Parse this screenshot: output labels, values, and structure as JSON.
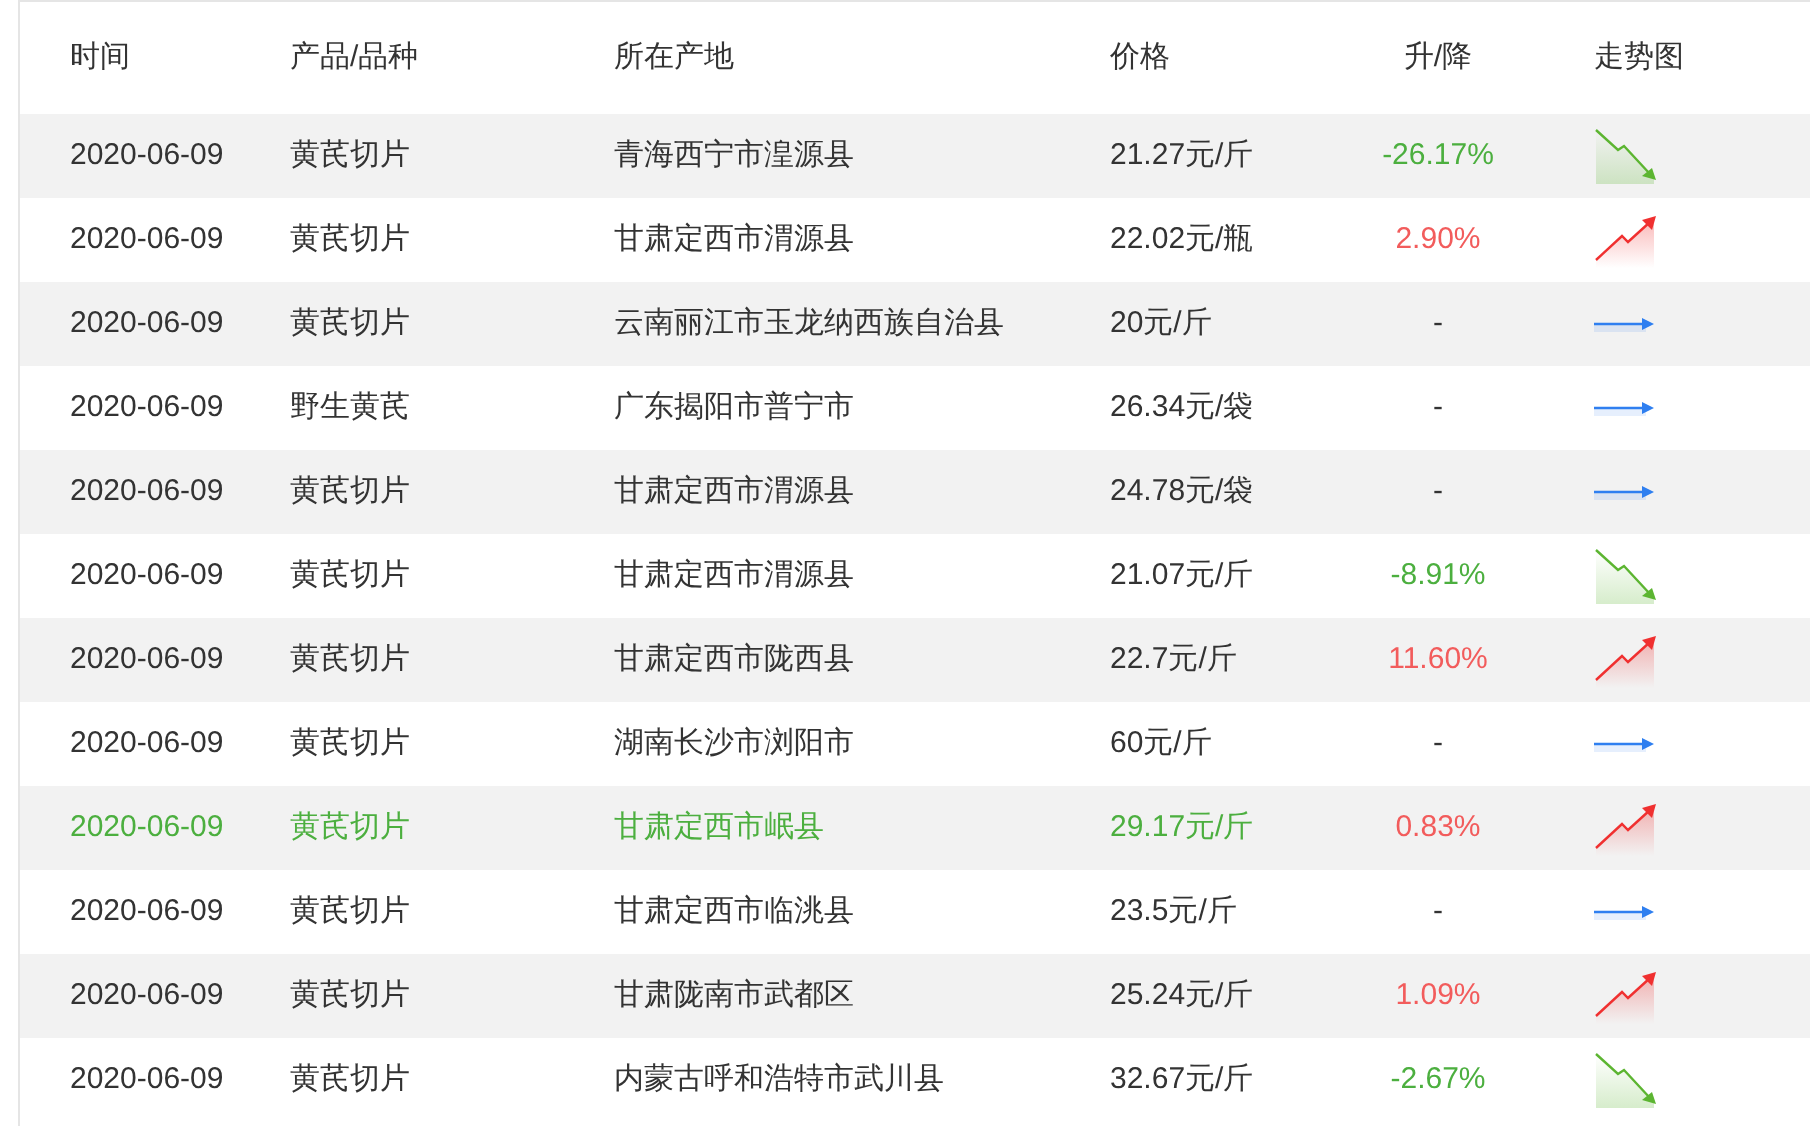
{
  "table": {
    "columns": [
      "时间",
      "产品/品种",
      "所在产地",
      "价格",
      "升/降",
      "走势图"
    ],
    "rows": [
      {
        "date": "2020-06-09",
        "product": "黄芪切片",
        "origin": "青海西宁市湟源县",
        "price": "21.27元/斤",
        "change": "-26.17%",
        "kind": "down",
        "selected": false
      },
      {
        "date": "2020-06-09",
        "product": "黄芪切片",
        "origin": "甘肃定西市渭源县",
        "price": "22.02元/瓶",
        "change": "2.90%",
        "kind": "up",
        "selected": false
      },
      {
        "date": "2020-06-09",
        "product": "黄芪切片",
        "origin": "云南丽江市玉龙纳西族自治县",
        "price": "20元/斤",
        "change": "-",
        "kind": "flat",
        "selected": false
      },
      {
        "date": "2020-06-09",
        "product": "野生黄芪",
        "origin": "广东揭阳市普宁市",
        "price": "26.34元/袋",
        "change": "-",
        "kind": "flat",
        "selected": false
      },
      {
        "date": "2020-06-09",
        "product": "黄芪切片",
        "origin": "甘肃定西市渭源县",
        "price": "24.78元/袋",
        "change": "-",
        "kind": "flat",
        "selected": false
      },
      {
        "date": "2020-06-09",
        "product": "黄芪切片",
        "origin": "甘肃定西市渭源县",
        "price": "21.07元/斤",
        "change": "-8.91%",
        "kind": "down",
        "selected": false
      },
      {
        "date": "2020-06-09",
        "product": "黄芪切片",
        "origin": "甘肃定西市陇西县",
        "price": "22.7元/斤",
        "change": "11.60%",
        "kind": "up",
        "selected": false
      },
      {
        "date": "2020-06-09",
        "product": "黄芪切片",
        "origin": "湖南长沙市浏阳市",
        "price": "60元/斤",
        "change": "-",
        "kind": "flat",
        "selected": false
      },
      {
        "date": "2020-06-09",
        "product": "黄芪切片",
        "origin": "甘肃定西市岷县",
        "price": "29.17元/斤",
        "change": "0.83%",
        "kind": "up",
        "selected": true
      },
      {
        "date": "2020-06-09",
        "product": "黄芪切片",
        "origin": "甘肃定西市临洮县",
        "price": "23.5元/斤",
        "change": "-",
        "kind": "flat",
        "selected": false
      },
      {
        "date": "2020-06-09",
        "product": "黄芪切片",
        "origin": "甘肃陇南市武都区",
        "price": "25.24元/斤",
        "change": "1.09%",
        "kind": "up",
        "selected": false
      },
      {
        "date": "2020-06-09",
        "product": "黄芪切片",
        "origin": "内蒙古呼和浩特市武川县",
        "price": "32.67元/斤",
        "change": "-2.67%",
        "kind": "down",
        "selected": false
      }
    ]
  }
}
